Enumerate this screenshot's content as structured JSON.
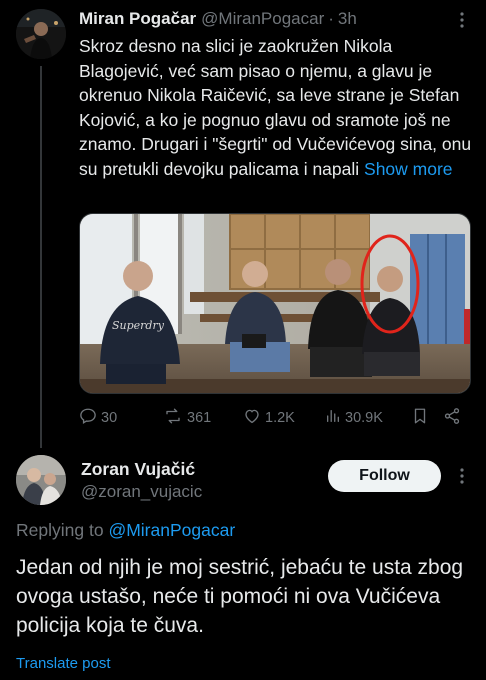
{
  "tweet1": {
    "author_name": "Miran Pogačar",
    "author_handle": "@MiranPogacar",
    "separator": "·",
    "time": "3h",
    "text": "Skroz desno na slici je zaokružen Nikola Blagojević, već sam pisao o njemu, a glavu je okrenuo Nikola Raičević, sa leve strane je Stefan Kojović, a ko je pognuo glavu od sramote još ne znamo. Drugari i \"šegrti\" od Vučevićevog sina, onu su pretukli devojku palicama i napali",
    "show_more": "Show more",
    "media": {
      "figure1_text": "Superdry"
    },
    "stats": {
      "replies": "30",
      "reposts": "361",
      "likes": "1.2K",
      "views": "30.9K"
    }
  },
  "tweet2": {
    "author_name": "Zoran Vujačić",
    "author_handle": "@zoran_vujacic",
    "follow_label": "Follow",
    "replying_prefix": "Replying to",
    "replying_to": "@MiranPogacar",
    "text": "Jedan od njih je moj sestrić, jebaću te usta zbog ovoga ustašo, neće ti pomoći ni ova Vučićeva policija koja te čuva.",
    "translate_label": "Translate post"
  },
  "colors": {
    "background": "#000000",
    "text": "#e7e9ea",
    "muted": "#71767b",
    "link": "#1d9bf0",
    "follow_bg": "#eff3f4",
    "circle_annotation": "#e0241b"
  },
  "icons": {
    "reply": "reply-icon",
    "repost": "repost-icon",
    "like": "like-icon",
    "views": "views-icon",
    "bookmark": "bookmark-icon",
    "share": "share-icon",
    "more": "more-icon"
  }
}
